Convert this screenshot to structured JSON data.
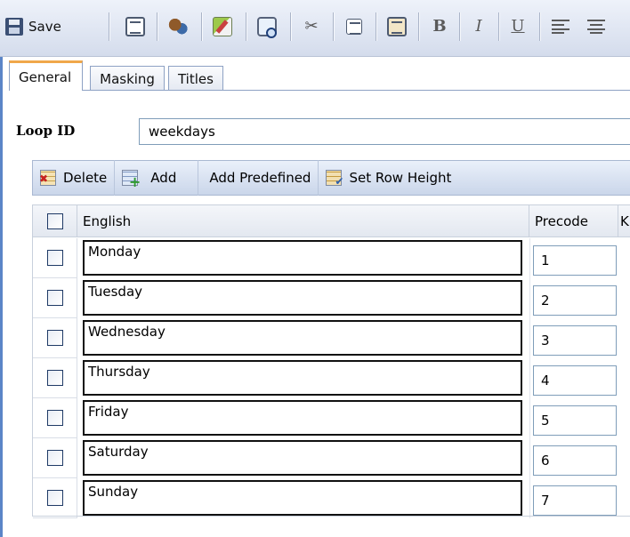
{
  "toolbar": {
    "save_label": "Save",
    "icons": [
      "save-icon",
      "copy-icon",
      "tools-icon",
      "edit-icon",
      "find-icon",
      "cut-icon",
      "copy-small-icon",
      "paste-icon",
      "bold-icon",
      "italic-icon",
      "underline-icon",
      "align-left-icon",
      "align-center-icon"
    ],
    "bold_glyph": "B",
    "italic_glyph": "I",
    "underline_glyph": "U"
  },
  "tabs": [
    {
      "label": "General",
      "active": true
    },
    {
      "label": "Masking",
      "active": false
    },
    {
      "label": "Titles",
      "active": false
    }
  ],
  "loop": {
    "label": "Loop ID",
    "value": "weekdays"
  },
  "grid_toolbar": {
    "delete_label": "Delete",
    "add_label": "Add",
    "add_predefined_label": "Add Predefined",
    "set_row_height_label": "Set Row Height"
  },
  "grid": {
    "columns": [
      "English",
      "Precode",
      "K"
    ],
    "rows": [
      {
        "english": "Monday",
        "precode": "1"
      },
      {
        "english": "Tuesday",
        "precode": "2"
      },
      {
        "english": "Wednesday",
        "precode": "3"
      },
      {
        "english": "Thursday",
        "precode": "4"
      },
      {
        "english": "Friday",
        "precode": "5"
      },
      {
        "english": "Saturday",
        "precode": "6"
      },
      {
        "english": "Sunday",
        "precode": "7"
      }
    ]
  },
  "colors": {
    "toolbar_bg": "#dbe3f1",
    "active_tab_accent": "#f0a74a",
    "left_border": "#5b85c7",
    "input_border": "#7f9db9"
  }
}
